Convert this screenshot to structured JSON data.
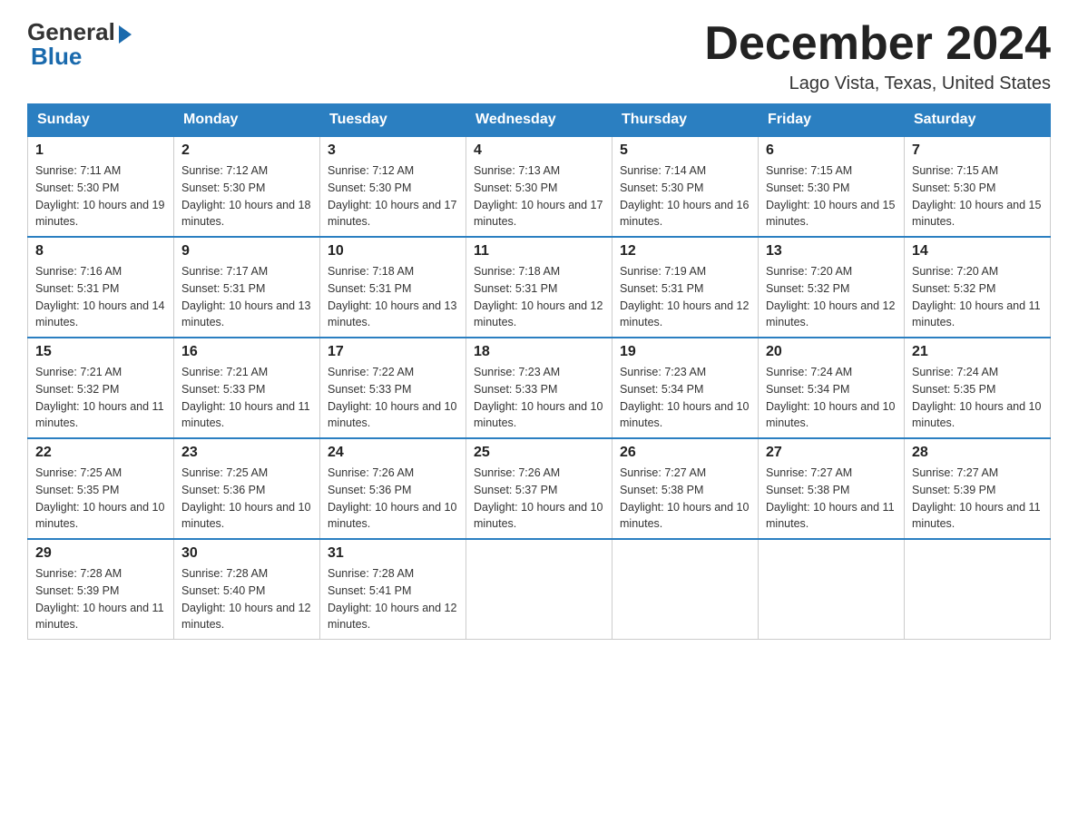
{
  "header": {
    "logo_general": "General",
    "logo_blue": "Blue",
    "month_title": "December 2024",
    "location": "Lago Vista, Texas, United States"
  },
  "days_of_week": [
    "Sunday",
    "Monday",
    "Tuesday",
    "Wednesday",
    "Thursday",
    "Friday",
    "Saturday"
  ],
  "weeks": [
    [
      {
        "day": "1",
        "sunrise": "7:11 AM",
        "sunset": "5:30 PM",
        "daylight": "10 hours and 19 minutes."
      },
      {
        "day": "2",
        "sunrise": "7:12 AM",
        "sunset": "5:30 PM",
        "daylight": "10 hours and 18 minutes."
      },
      {
        "day": "3",
        "sunrise": "7:12 AM",
        "sunset": "5:30 PM",
        "daylight": "10 hours and 17 minutes."
      },
      {
        "day": "4",
        "sunrise": "7:13 AM",
        "sunset": "5:30 PM",
        "daylight": "10 hours and 17 minutes."
      },
      {
        "day": "5",
        "sunrise": "7:14 AM",
        "sunset": "5:30 PM",
        "daylight": "10 hours and 16 minutes."
      },
      {
        "day": "6",
        "sunrise": "7:15 AM",
        "sunset": "5:30 PM",
        "daylight": "10 hours and 15 minutes."
      },
      {
        "day": "7",
        "sunrise": "7:15 AM",
        "sunset": "5:30 PM",
        "daylight": "10 hours and 15 minutes."
      }
    ],
    [
      {
        "day": "8",
        "sunrise": "7:16 AM",
        "sunset": "5:31 PM",
        "daylight": "10 hours and 14 minutes."
      },
      {
        "day": "9",
        "sunrise": "7:17 AM",
        "sunset": "5:31 PM",
        "daylight": "10 hours and 13 minutes."
      },
      {
        "day": "10",
        "sunrise": "7:18 AM",
        "sunset": "5:31 PM",
        "daylight": "10 hours and 13 minutes."
      },
      {
        "day": "11",
        "sunrise": "7:18 AM",
        "sunset": "5:31 PM",
        "daylight": "10 hours and 12 minutes."
      },
      {
        "day": "12",
        "sunrise": "7:19 AM",
        "sunset": "5:31 PM",
        "daylight": "10 hours and 12 minutes."
      },
      {
        "day": "13",
        "sunrise": "7:20 AM",
        "sunset": "5:32 PM",
        "daylight": "10 hours and 12 minutes."
      },
      {
        "day": "14",
        "sunrise": "7:20 AM",
        "sunset": "5:32 PM",
        "daylight": "10 hours and 11 minutes."
      }
    ],
    [
      {
        "day": "15",
        "sunrise": "7:21 AM",
        "sunset": "5:32 PM",
        "daylight": "10 hours and 11 minutes."
      },
      {
        "day": "16",
        "sunrise": "7:21 AM",
        "sunset": "5:33 PM",
        "daylight": "10 hours and 11 minutes."
      },
      {
        "day": "17",
        "sunrise": "7:22 AM",
        "sunset": "5:33 PM",
        "daylight": "10 hours and 10 minutes."
      },
      {
        "day": "18",
        "sunrise": "7:23 AM",
        "sunset": "5:33 PM",
        "daylight": "10 hours and 10 minutes."
      },
      {
        "day": "19",
        "sunrise": "7:23 AM",
        "sunset": "5:34 PM",
        "daylight": "10 hours and 10 minutes."
      },
      {
        "day": "20",
        "sunrise": "7:24 AM",
        "sunset": "5:34 PM",
        "daylight": "10 hours and 10 minutes."
      },
      {
        "day": "21",
        "sunrise": "7:24 AM",
        "sunset": "5:35 PM",
        "daylight": "10 hours and 10 minutes."
      }
    ],
    [
      {
        "day": "22",
        "sunrise": "7:25 AM",
        "sunset": "5:35 PM",
        "daylight": "10 hours and 10 minutes."
      },
      {
        "day": "23",
        "sunrise": "7:25 AM",
        "sunset": "5:36 PM",
        "daylight": "10 hours and 10 minutes."
      },
      {
        "day": "24",
        "sunrise": "7:26 AM",
        "sunset": "5:36 PM",
        "daylight": "10 hours and 10 minutes."
      },
      {
        "day": "25",
        "sunrise": "7:26 AM",
        "sunset": "5:37 PM",
        "daylight": "10 hours and 10 minutes."
      },
      {
        "day": "26",
        "sunrise": "7:27 AM",
        "sunset": "5:38 PM",
        "daylight": "10 hours and 10 minutes."
      },
      {
        "day": "27",
        "sunrise": "7:27 AM",
        "sunset": "5:38 PM",
        "daylight": "10 hours and 11 minutes."
      },
      {
        "day": "28",
        "sunrise": "7:27 AM",
        "sunset": "5:39 PM",
        "daylight": "10 hours and 11 minutes."
      }
    ],
    [
      {
        "day": "29",
        "sunrise": "7:28 AM",
        "sunset": "5:39 PM",
        "daylight": "10 hours and 11 minutes."
      },
      {
        "day": "30",
        "sunrise": "7:28 AM",
        "sunset": "5:40 PM",
        "daylight": "10 hours and 12 minutes."
      },
      {
        "day": "31",
        "sunrise": "7:28 AM",
        "sunset": "5:41 PM",
        "daylight": "10 hours and 12 minutes."
      },
      null,
      null,
      null,
      null
    ]
  ]
}
